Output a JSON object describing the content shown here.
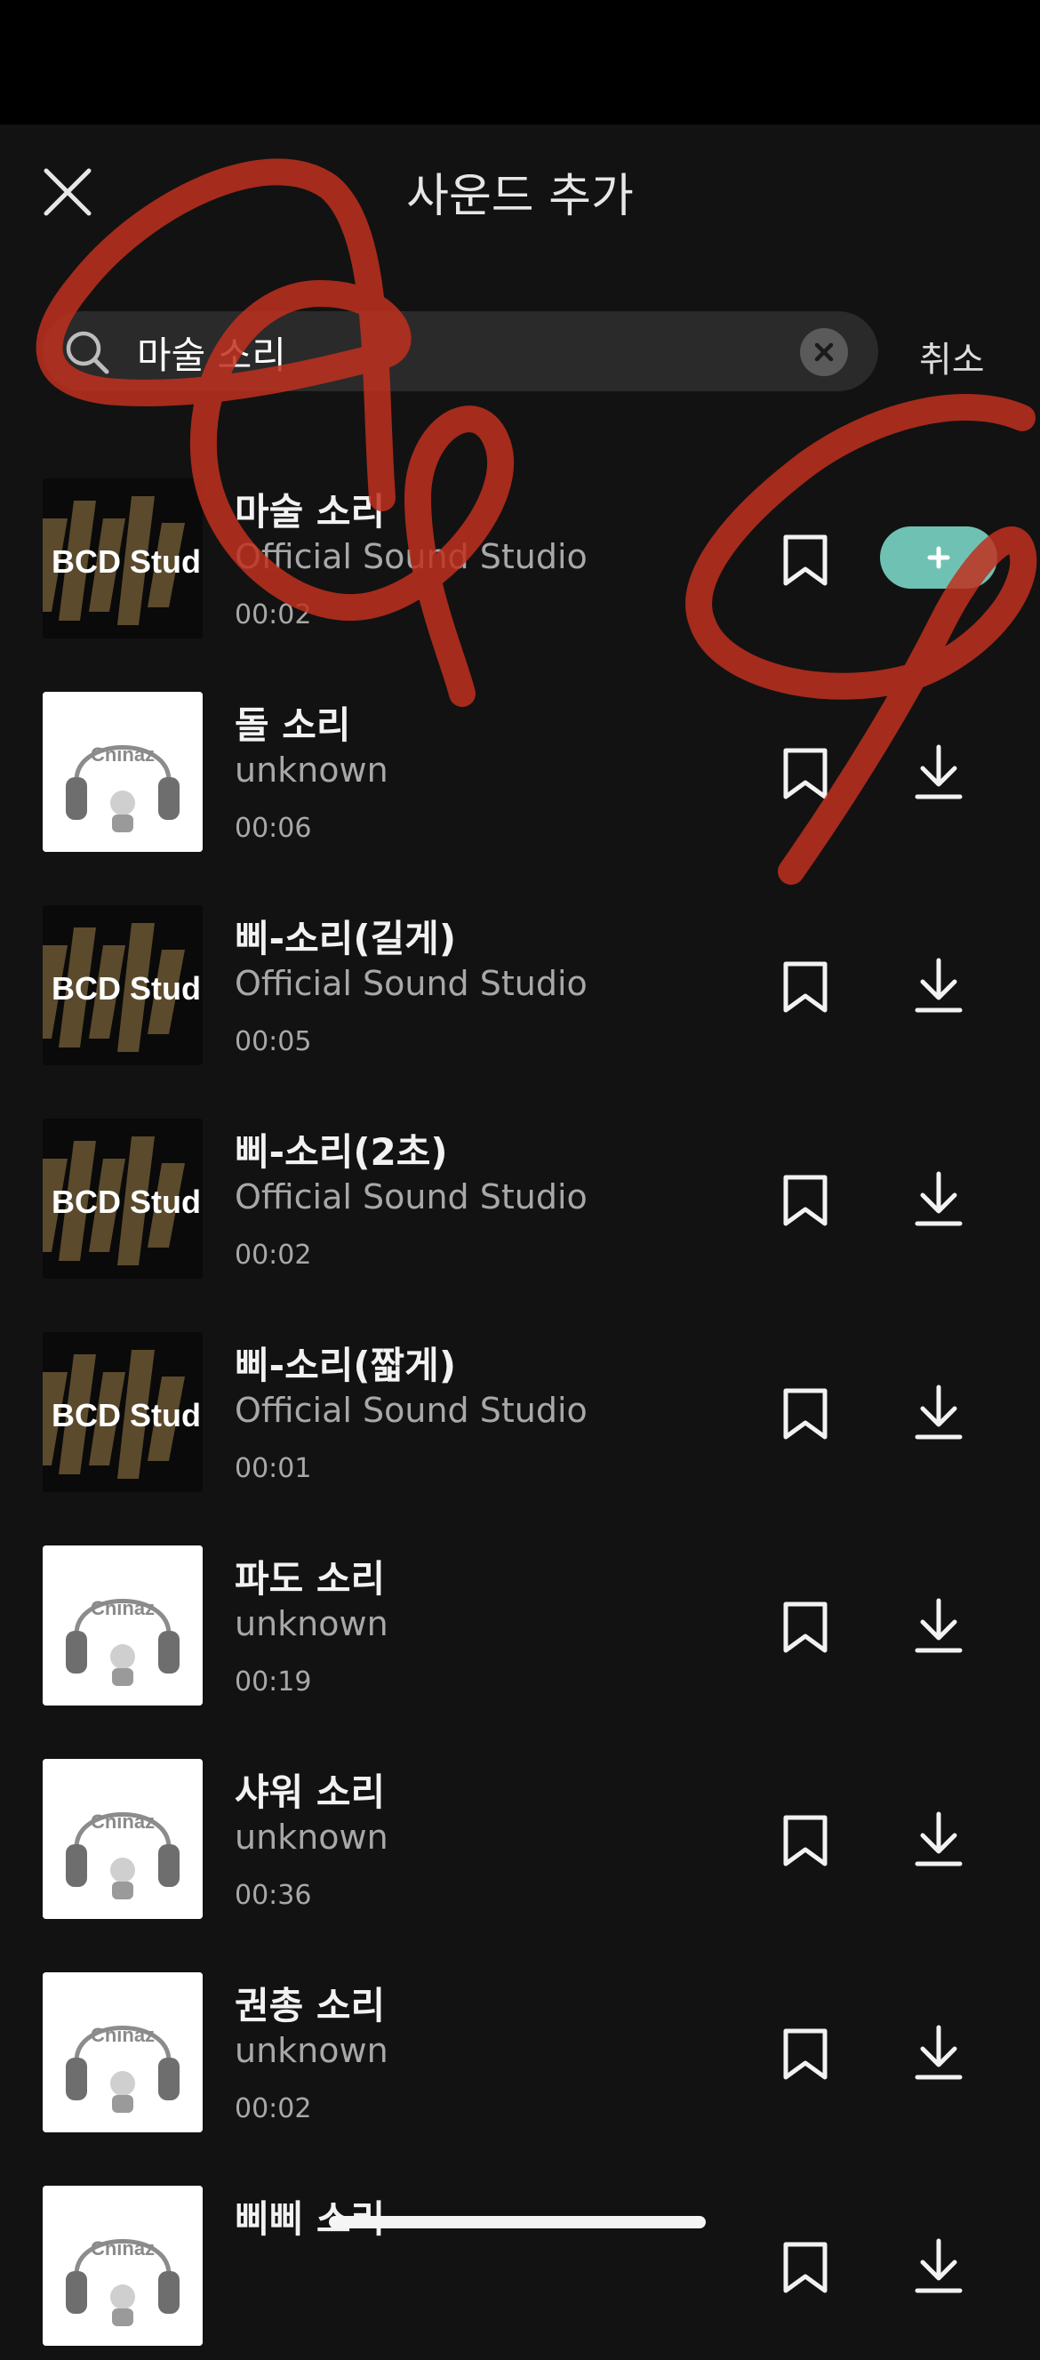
{
  "header": {
    "title": "사운드 추가",
    "close_icon": "close-icon"
  },
  "search": {
    "value": "마술 소리",
    "cancel_label": "취소",
    "icon": "search-icon",
    "clear_icon": "clear-icon"
  },
  "results": [
    {
      "name": "마술 소리",
      "artist": "Official Sound Studio",
      "duration": "00:02",
      "thumb": "bcd-studio-logo",
      "action": "add"
    },
    {
      "name": "돌 소리",
      "artist": "unknown",
      "duration": "00:06",
      "thumb": "chinaz-logo",
      "action": "download"
    },
    {
      "name": "삐-소리(길게)",
      "artist": "Official Sound Studio",
      "duration": "00:05",
      "thumb": "bcd-studio-logo",
      "action": "download"
    },
    {
      "name": "삐-소리(2초)",
      "artist": "Official Sound Studio",
      "duration": "00:02",
      "thumb": "bcd-studio-logo",
      "action": "download"
    },
    {
      "name": "삐-소리(짧게)",
      "artist": "Official Sound Studio",
      "duration": "00:01",
      "thumb": "bcd-studio-logo",
      "action": "download"
    },
    {
      "name": "파도 소리",
      "artist": "unknown",
      "duration": "00:19",
      "thumb": "chinaz-logo",
      "action": "download"
    },
    {
      "name": "샤워 소리",
      "artist": "unknown",
      "duration": "00:36",
      "thumb": "chinaz-logo",
      "action": "download"
    },
    {
      "name": "권총 소리",
      "artist": "unknown",
      "duration": "00:02",
      "thumb": "chinaz-logo",
      "action": "download"
    },
    {
      "name": "삐삐 소리",
      "artist": "",
      "duration": "",
      "thumb": "chinaz-logo",
      "action": "download"
    }
  ],
  "logos": {
    "bcd": "BCD Studio",
    "chinaz": "Chinaz"
  },
  "colors": {
    "background": "#121212",
    "accent": "#6fc2b3",
    "scribble": "#c0301f"
  }
}
